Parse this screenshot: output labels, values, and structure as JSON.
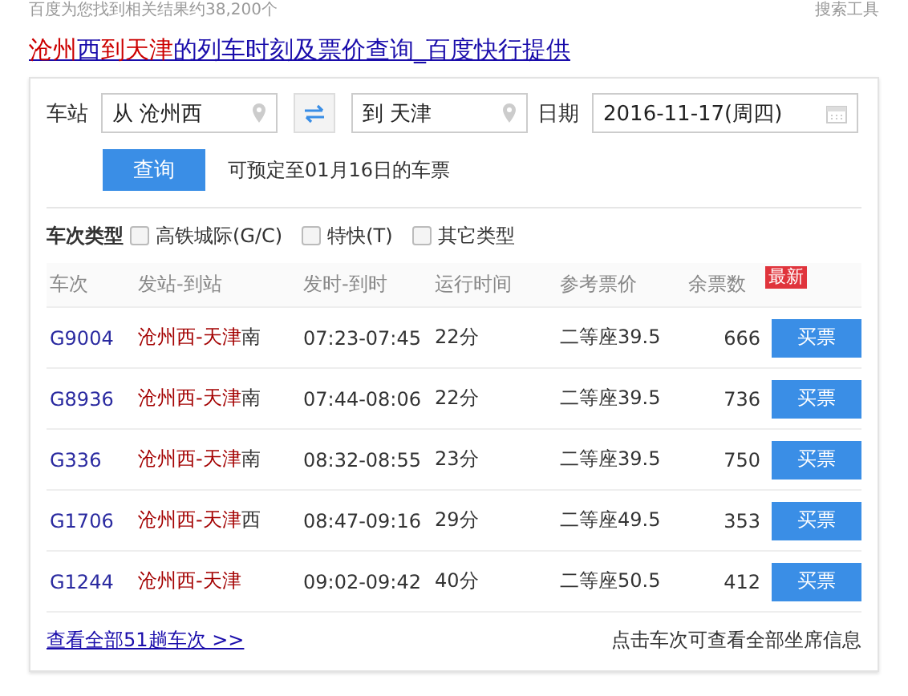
{
  "top_bar": {
    "result_count": "百度为您找到相关结果约38,200个",
    "tools": "搜索工具"
  },
  "title": [
    {
      "text": "沧州",
      "highlight": true
    },
    {
      "text": "西",
      "highlight": false
    },
    {
      "text": "到天津",
      "highlight": true
    },
    {
      "text": "的列车时刻及票价查询_百度快行提供",
      "highlight": false
    }
  ],
  "search": {
    "station_label": "车站",
    "from": "从 沧州西",
    "to": "到 天津",
    "date_label": "日期",
    "date": "2016-11-17(周四)",
    "query_button": "查询",
    "note": "可预定至01月16日的车票"
  },
  "filters": {
    "label": "车次类型",
    "options": [
      {
        "label": "高铁城际(G/C)",
        "checked": false
      },
      {
        "label": "特快(T)",
        "checked": false
      },
      {
        "label": "其它类型",
        "checked": false
      }
    ]
  },
  "table": {
    "columns": [
      "车次",
      "发站-到站",
      "发时-到时",
      "运行时间",
      "参考票价",
      "余票数"
    ],
    "new_badge": "最新",
    "rows": [
      {
        "train": "G9004",
        "route_match": "沧州西-天津",
        "route_rest": "南",
        "times": "07:23-07:45",
        "duration": "22分",
        "price": "二等座39.5",
        "remaining": "666",
        "button": "买票"
      },
      {
        "train": "G8936",
        "route_match": "沧州西-天津",
        "route_rest": "南",
        "times": "07:44-08:06",
        "duration": "22分",
        "price": "二等座39.5",
        "remaining": "736",
        "button": "买票"
      },
      {
        "train": "G336",
        "route_match": "沧州西-天津",
        "route_rest": "南",
        "times": "08:32-08:55",
        "duration": "23分",
        "price": "二等座39.5",
        "remaining": "750",
        "button": "买票"
      },
      {
        "train": "G1706",
        "route_match": "沧州西-天津",
        "route_rest": "西",
        "times": "08:47-09:16",
        "duration": "29分",
        "price": "二等座49.5",
        "remaining": "353",
        "button": "买票"
      },
      {
        "train": "G1244",
        "route_match": "沧州西-天津",
        "route_rest": "",
        "times": "09:02-09:42",
        "duration": "40分",
        "price": "二等座50.5",
        "remaining": "412",
        "button": "买票"
      }
    ]
  },
  "footer": {
    "link": "查看全部51趟车次 >>",
    "hint": "点击车次可查看全部坐席信息"
  }
}
